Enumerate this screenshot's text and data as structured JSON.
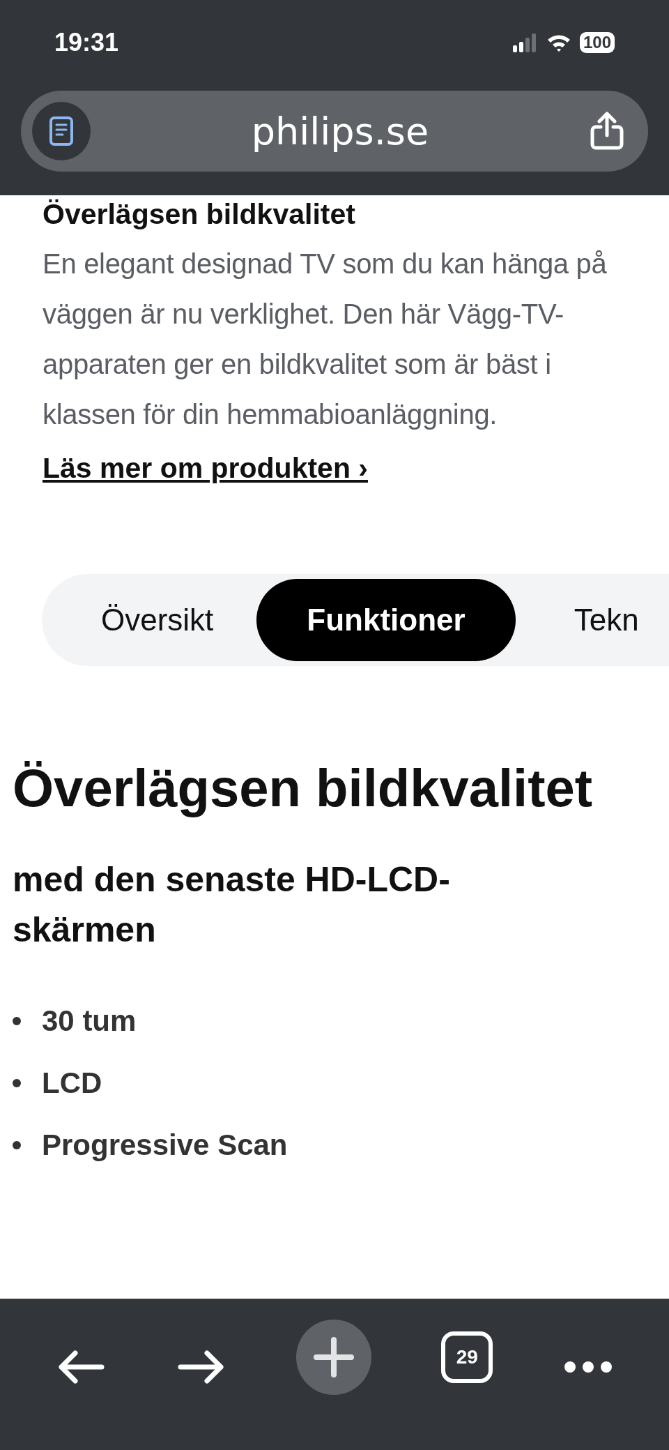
{
  "status_bar": {
    "time": "19:31",
    "battery": "100"
  },
  "address_bar": {
    "url": "philips.se"
  },
  "intro": {
    "heading": "Överlägsen bildkvalitet",
    "text": "En elegant designad TV som du kan hänga på väggen är nu verklighet. Den här Vägg-TV-apparaten ger en bildkvalitet som är bäst i klassen för din hemmabioanläggning.",
    "link": "Läs mer om produkten ›"
  },
  "tabs": [
    {
      "label": "Översikt",
      "selected": false
    },
    {
      "label": "Funktioner",
      "selected": true
    },
    {
      "label": "Tekn",
      "selected": false
    }
  ],
  "feature": {
    "title": "Överlägsen bildkvalitet",
    "subtitle": "med den senaste HD-LCD-skärmen",
    "bullets": [
      "30 tum",
      "LCD",
      "Progressive Scan"
    ]
  },
  "toolbar": {
    "tab_count": "29"
  }
}
